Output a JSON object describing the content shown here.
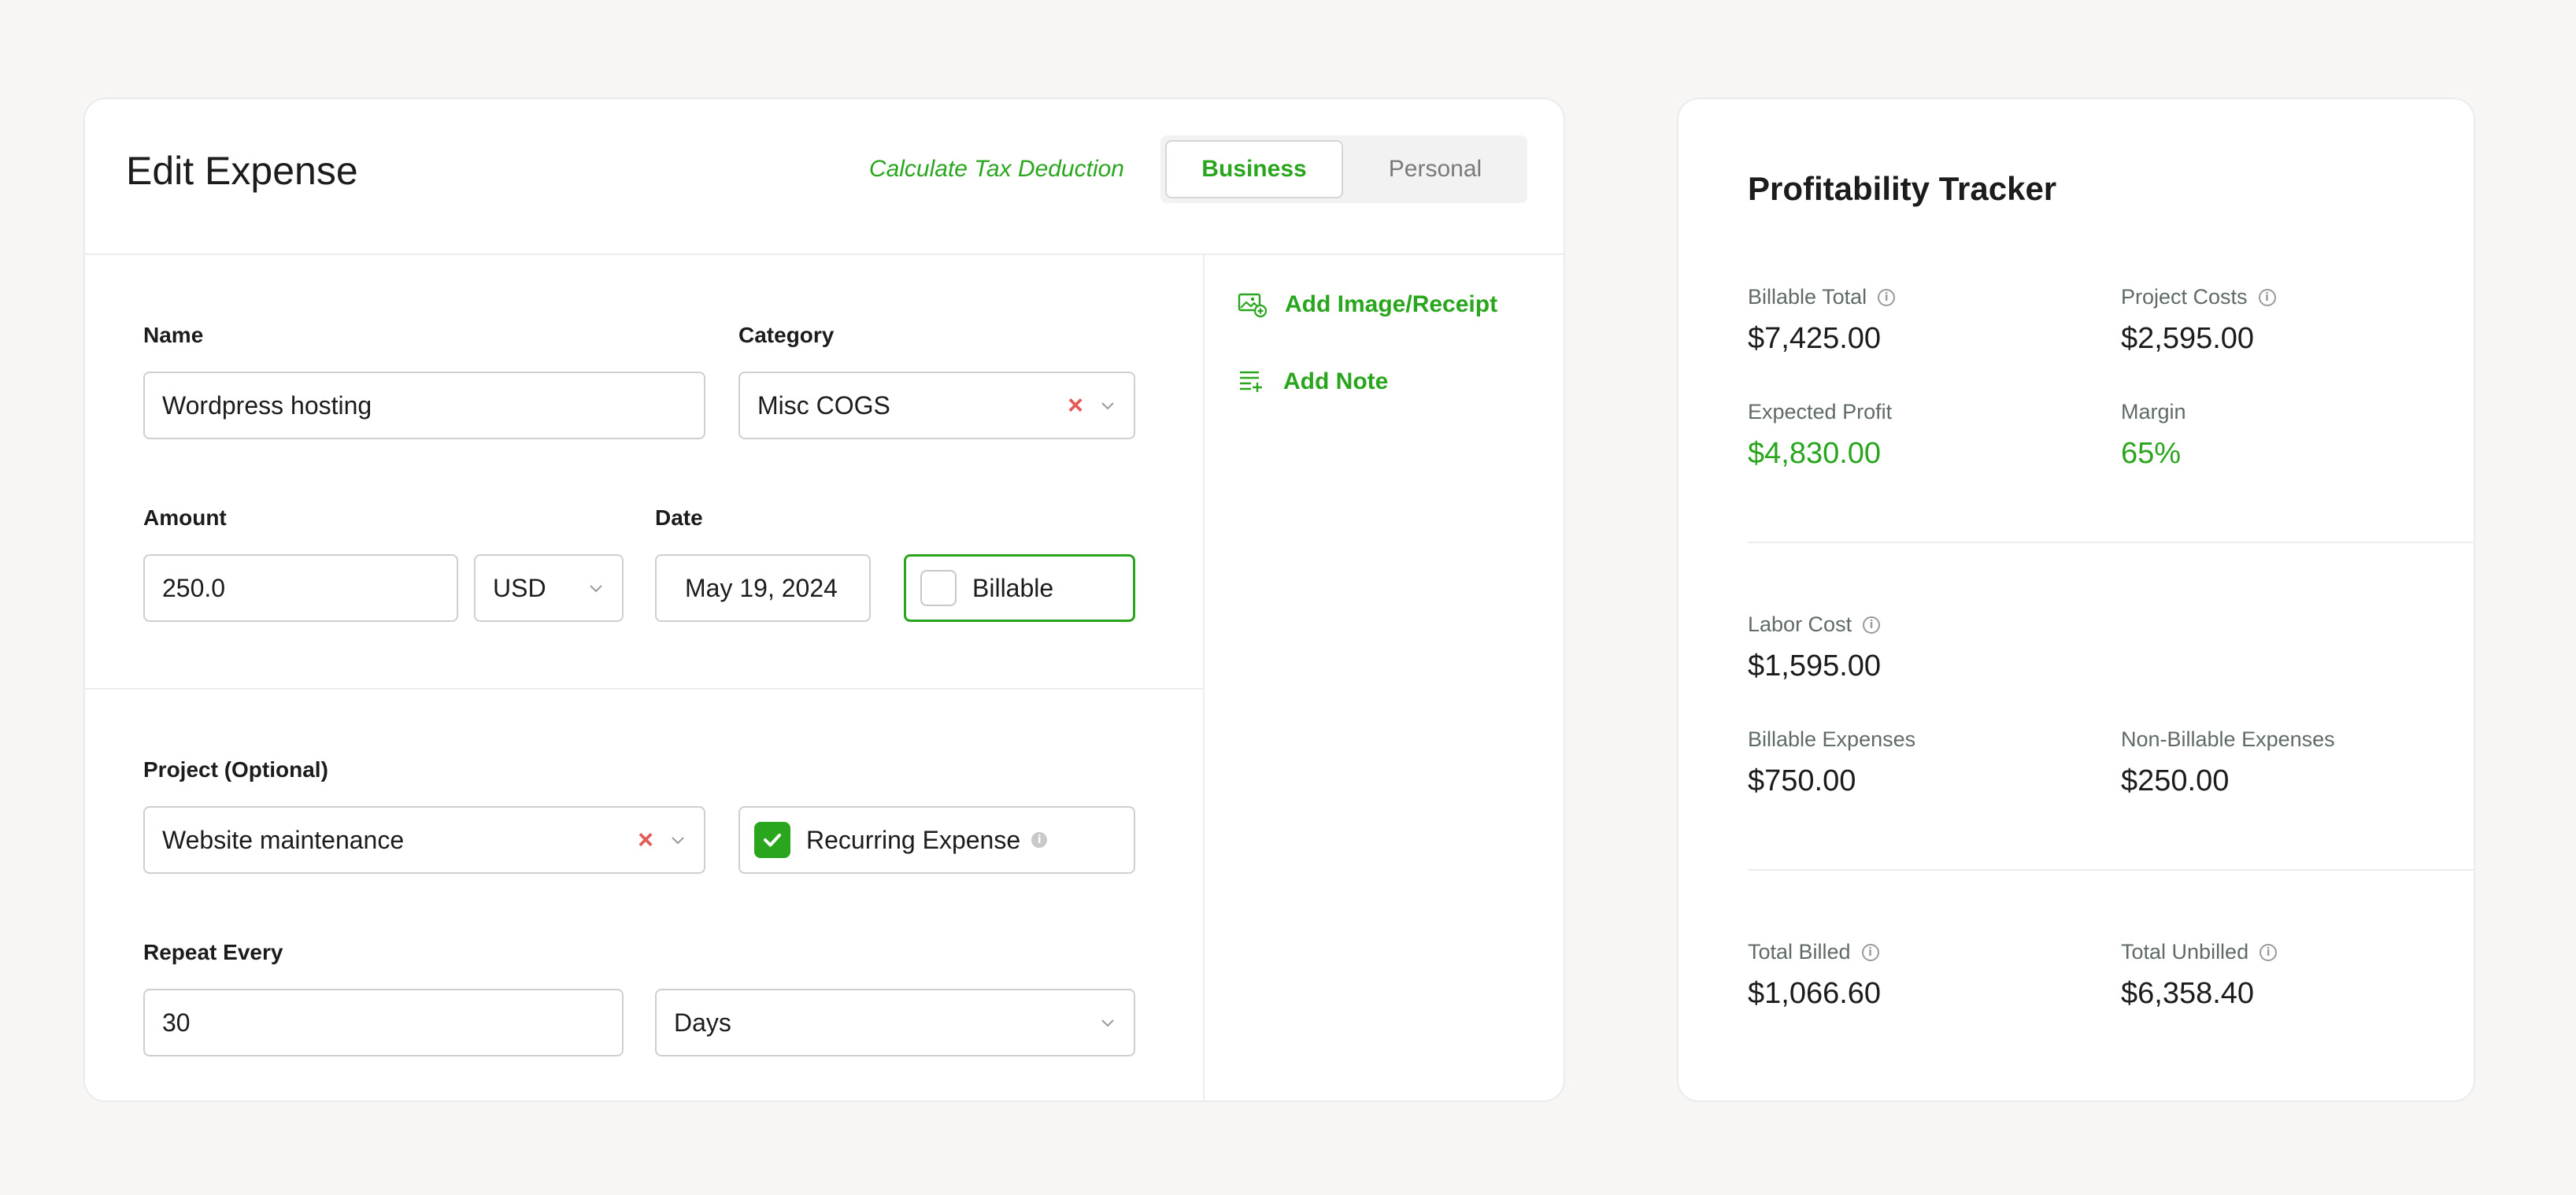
{
  "edit_expense": {
    "title": "Edit Expense",
    "tax_link": "Calculate Tax Deduction",
    "toggle": {
      "business": "Business",
      "personal": "Personal",
      "selected": "Business"
    },
    "name": {
      "label": "Name",
      "value": "Wordpress hosting"
    },
    "category": {
      "label": "Category",
      "value": "Misc COGS"
    },
    "amount": {
      "label": "Amount",
      "value": "250.0",
      "currency": "USD"
    },
    "date": {
      "label": "Date",
      "value": "May 19, 2024"
    },
    "billable": {
      "label": "Billable",
      "checked": false
    },
    "project": {
      "label": "Project (Optional)",
      "value": "Website maintenance"
    },
    "recurring": {
      "label": "Recurring Expense",
      "checked": true
    },
    "repeat": {
      "label": "Repeat Every",
      "value": "30",
      "unit": "Days"
    },
    "actions": {
      "add_image": "Add Image/Receipt",
      "add_note": "Add Note"
    },
    "colors": {
      "accent": "#2aa51e",
      "clear": "#e25b57"
    }
  },
  "tracker": {
    "title": "Profitability Tracker",
    "billable_total": {
      "label": "Billable Total",
      "value": "$7,425.00"
    },
    "project_costs": {
      "label": "Project Costs",
      "value": "$2,595.00"
    },
    "expected_profit": {
      "label": "Expected Profit",
      "value": "$4,830.00"
    },
    "margin": {
      "label": "Margin",
      "value": "65%"
    },
    "labor_cost": {
      "label": "Labor Cost",
      "value": "$1,595.00"
    },
    "billable_expenses": {
      "label": "Billable Expenses",
      "value": "$750.00"
    },
    "non_billable_expenses": {
      "label": "Non-Billable Expenses",
      "value": "$250.00"
    },
    "total_billed": {
      "label": "Total Billed",
      "value": "$1,066.60"
    },
    "total_unbilled": {
      "label": "Total Unbilled",
      "value": "$6,358.40"
    }
  }
}
